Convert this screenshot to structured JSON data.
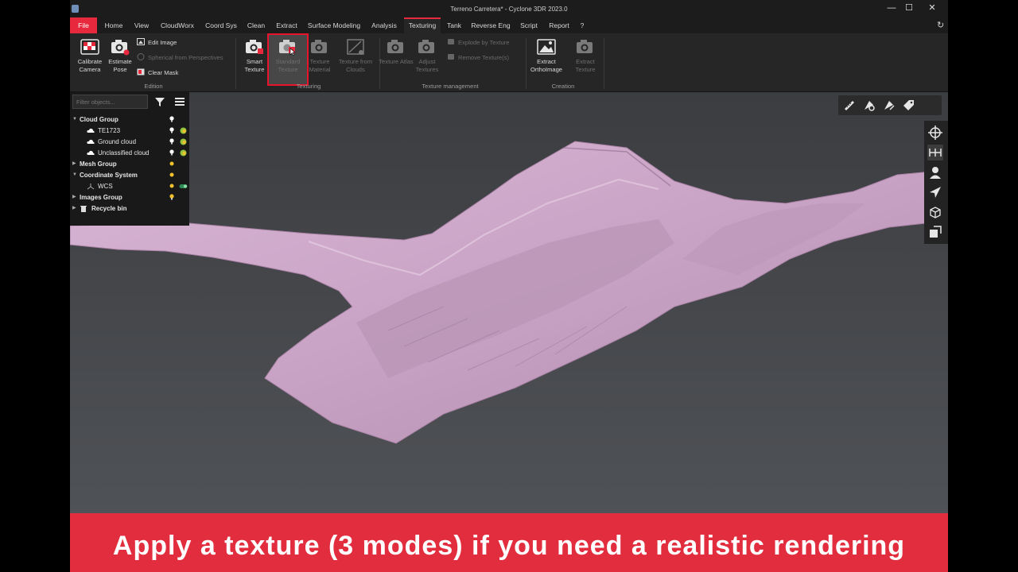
{
  "window": {
    "title": "Terreno Carretera* - Cyclone 3DR 2023.0",
    "minimize": "—",
    "maximize": "☐",
    "close": "✕"
  },
  "menu": {
    "items": [
      "File",
      "Home",
      "View",
      "CloudWorx",
      "Coord Sys",
      "Clean",
      "Extract",
      "Surface Modeling",
      "Analysis",
      "Texturing",
      "Tank",
      "Reverse Eng",
      "Script",
      "Report",
      "?"
    ],
    "active": "Texturing",
    "refresh_icon": "↻"
  },
  "ribbon": {
    "edition": {
      "label": "Edition",
      "calibrate_camera": "Calibrate Camera",
      "estimate_pose": "Estimate Pose",
      "edit_image": "Edit Image",
      "spherical_from_perspectives": "Spherical from Perspectives",
      "clear_mask": "Clear Mask"
    },
    "texturing": {
      "label": "Texturing",
      "smart_texture": "Smart Texture",
      "standard_texture": "Standard Texture",
      "texture_material": "Texture Material",
      "texture_from_clouds": "Texture from Clouds"
    },
    "texture_management": {
      "label": "Texture management",
      "texture_atlas": "Texture Atlas",
      "adjust_textures": "Adjust Textures",
      "explode_by_texture": "Explode by Texture",
      "remove_textures": "Remove Texture(s)"
    },
    "creation": {
      "label": "Creation",
      "extract_orthoimage": "Extract OrthoImage",
      "extract_texture": "Extract Texture"
    }
  },
  "tree": {
    "filter_placeholder": "Filter objects...",
    "items": [
      {
        "label": "Cloud Group",
        "level": 0
      },
      {
        "label": "TE1723",
        "level": 1
      },
      {
        "label": "Ground cloud",
        "level": 1
      },
      {
        "label": "Unclassified cloud",
        "level": 1
      },
      {
        "label": "Mesh Group",
        "level": 0
      },
      {
        "label": "Coordinate System",
        "level": 0
      },
      {
        "label": "WCS",
        "level": 1
      },
      {
        "label": "Images Group",
        "level": 0
      },
      {
        "label": "Recycle bin",
        "level": 0
      }
    ]
  },
  "caption": {
    "text": "Apply a texture (3 modes) if you need a realistic rendering"
  },
  "colors": {
    "accent": "#e8283c",
    "mesh": "#c8a3c4",
    "caption_bg": "#e22d3f"
  }
}
